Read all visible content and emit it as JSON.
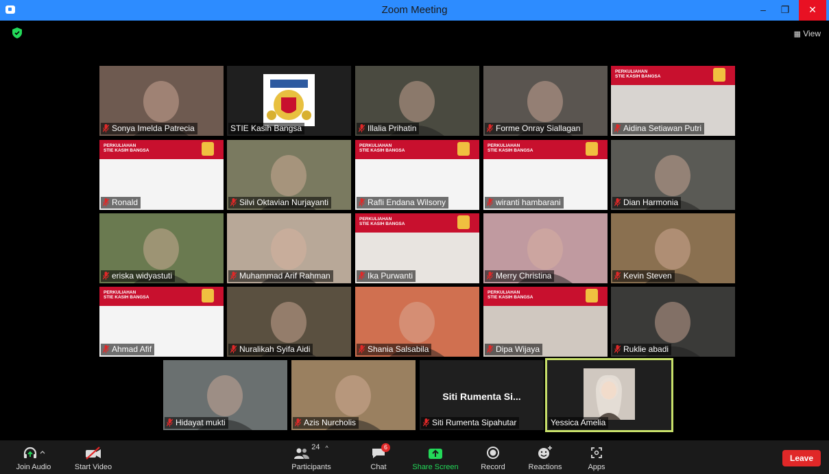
{
  "window": {
    "title": "Zoom Meeting",
    "minimize": "–",
    "restore": "❐",
    "close": "✕"
  },
  "header": {
    "view_label": "View"
  },
  "banner_text": "PERKULIAHAN\nSTIE KASIH BANGSA",
  "participants": [
    {
      "name": "Sonya Imelda Patrecia",
      "muted": true,
      "bg": "#6e5a50"
    },
    {
      "name": "STIE Kasih Bangsa",
      "muted": false,
      "bg": "#1f1f1f",
      "logo": true
    },
    {
      "name": "Illalia Prihatin",
      "muted": true,
      "bg": "#4a4a40"
    },
    {
      "name": "Forme Onray Siallagan",
      "muted": true,
      "bg": "#5a5550"
    },
    {
      "name": "Aidina Setiawan Putri",
      "muted": true,
      "bg": "#d8d4d0",
      "banner": true
    },
    {
      "name": "Ronald",
      "muted": true,
      "bg": "#f4f4f4",
      "banner": true
    },
    {
      "name": "Silvi Oktavian Nurjayanti",
      "muted": true,
      "bg": "#7a7a60"
    },
    {
      "name": "Rafli Endana Wilsony",
      "muted": true,
      "bg": "#f4f4f4",
      "banner": true
    },
    {
      "name": "wiranti hambarani",
      "muted": true,
      "bg": "#f4f4f4",
      "banner": true
    },
    {
      "name": "Dian Harmonia",
      "muted": true,
      "bg": "#5a5a55"
    },
    {
      "name": "eriska widyastuti",
      "muted": true,
      "bg": "#6a7a50"
    },
    {
      "name": "Muhammad Arif Rahman",
      "muted": true,
      "bg": "#b8a898"
    },
    {
      "name": "Ika Purwanti",
      "muted": true,
      "bg": "#e8e4e0",
      "banner": true
    },
    {
      "name": "Merry Christina",
      "muted": true,
      "bg": "#c09aa0"
    },
    {
      "name": "Kevin Steven",
      "muted": true,
      "bg": "#8a7050"
    },
    {
      "name": "Ahmad Afif",
      "muted": true,
      "bg": "#f4f4f4",
      "banner": true
    },
    {
      "name": "Nuralikah Syifa Aidi",
      "muted": true,
      "bg": "#5a5040"
    },
    {
      "name": "Shania Salsabila",
      "muted": true,
      "bg": "#d07050"
    },
    {
      "name": "Dipa Wijaya",
      "muted": true,
      "bg": "#d0c8c0",
      "banner": true
    },
    {
      "name": "Ruklie abadi",
      "muted": true,
      "bg": "#3a3a38"
    }
  ],
  "bottom_row": [
    {
      "name": "Hidayat mukti",
      "muted": true,
      "bg": "#6a7070"
    },
    {
      "name": "Azis Nurcholis",
      "muted": true,
      "bg": "#9a8060"
    },
    {
      "name": "Siti Rumenta Sipahutar",
      "muted": true,
      "display": "Siti Rumenta Si..."
    },
    {
      "name": "Yessica Amelia",
      "muted": false,
      "bg": "#c8c0b8",
      "active": true
    }
  ],
  "toolbar": {
    "join_audio": "Join Audio",
    "start_video": "Start Video",
    "participants": "Participants",
    "participants_count": "24",
    "chat": "Chat",
    "chat_badge": "6",
    "share_screen": "Share Screen",
    "record": "Record",
    "reactions": "Reactions",
    "apps": "Apps",
    "leave": "Leave"
  },
  "colors": {
    "accent": "#2d8cff",
    "share": "#23d959",
    "leave": "#e02828",
    "muted": "#e02828",
    "active_border": "#c8e06a"
  }
}
